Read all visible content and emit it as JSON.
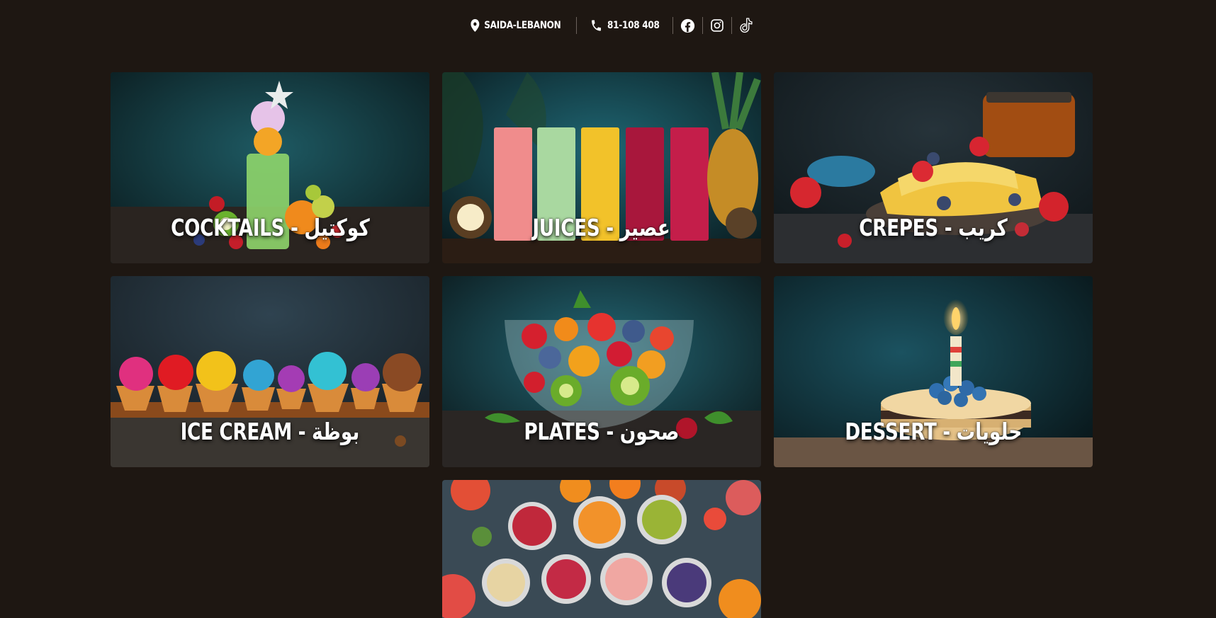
{
  "header": {
    "location_icon": "map-pin-icon",
    "location": "SAIDA-LEBANON",
    "phone_icon": "phone-icon",
    "phone": "81-108 408",
    "social": [
      "facebook-icon",
      "instagram-icon",
      "tiktok-icon"
    ]
  },
  "categories": [
    {
      "title": "COCKTAILS - كوكتيل"
    },
    {
      "title": "JUICES - عصير"
    },
    {
      "title": "CREPES - كريب"
    },
    {
      "title": "ICE CREAM - بوظة"
    },
    {
      "title": "PLATES - صحون"
    },
    {
      "title": "DESSERT - حلويات"
    },
    {
      "title": ""
    }
  ],
  "colors": {
    "background": "#1e1712",
    "text": "#ffffff",
    "separator": "#6b625c"
  }
}
